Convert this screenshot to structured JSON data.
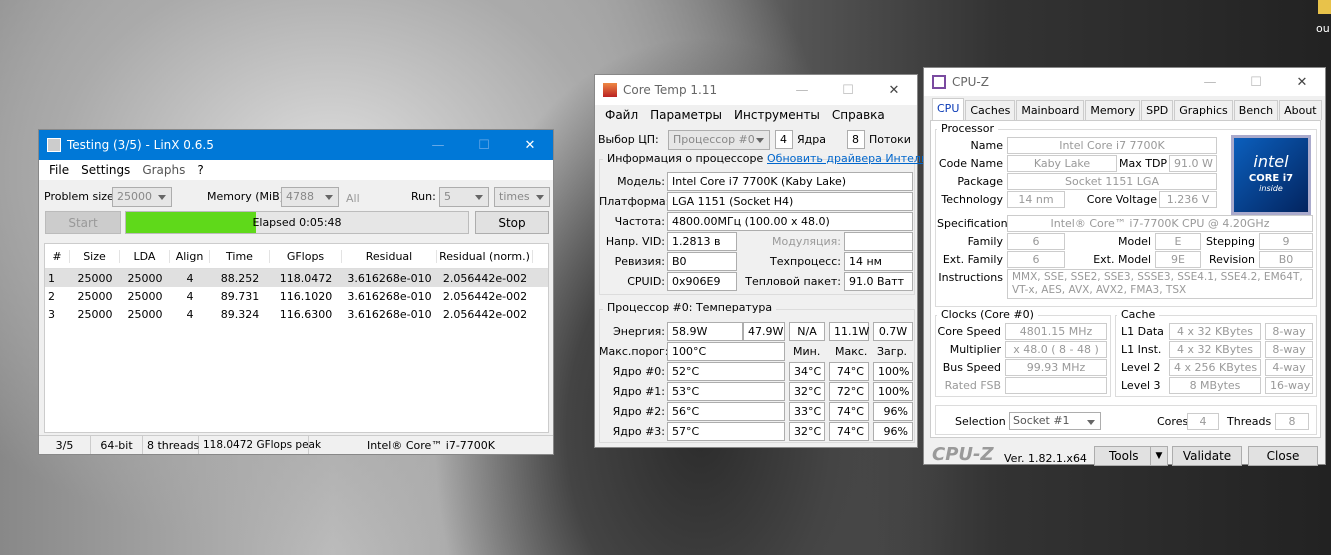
{
  "desktop_label": "ou",
  "linx": {
    "title": "Testing (3/5) - LinX 0.6.5",
    "menu": [
      "File",
      "Settings",
      "Graphs",
      "?"
    ],
    "problem_size_label": "Problem size:",
    "problem_size": "25000",
    "memory_label": "Memory (MiB):",
    "memory": "4788",
    "all_label": "All",
    "run_label": "Run:",
    "run": "5",
    "times": "times",
    "start": "Start",
    "elapsed": "Elapsed 0:05:48",
    "progress": 0.38,
    "stop": "Stop",
    "columns": [
      "#",
      "Size",
      "LDA",
      "Align",
      "Time",
      "GFlops",
      "Residual",
      "Residual (norm.)"
    ],
    "rows": [
      [
        "1",
        "25000",
        "25000",
        "4",
        "88.252",
        "118.0472",
        "3.616268e-010",
        "2.056442e-002"
      ],
      [
        "2",
        "25000",
        "25000",
        "4",
        "89.731",
        "116.1020",
        "3.616268e-010",
        "2.056442e-002"
      ],
      [
        "3",
        "25000",
        "25000",
        "4",
        "89.324",
        "116.6300",
        "3.616268e-010",
        "2.056442e-002"
      ]
    ],
    "status": [
      "3/5",
      "64-bit",
      "8 threads",
      "118.0472 GFlops peak",
      "Intel® Core™ i7-7700K"
    ]
  },
  "coretemp": {
    "title": "Core Temp 1.11",
    "menu": [
      "Файл",
      "Параметры",
      "Инструменты",
      "Справка"
    ],
    "cpu_select_label": "Выбор ЦП:",
    "cpu_select": "Процессор #0",
    "cores": "4",
    "cores_label": "Ядра",
    "threads": "8",
    "threads_label": "Потоки",
    "info_group": "Информация о процессоре",
    "update_link": "Обновить драйвера Интель",
    "model_label": "Модель:",
    "model": "Intel Core i7 7700K (Kaby Lake)",
    "platform_label": "Платформа:",
    "platform": "LGA 1151 (Socket H4)",
    "freq_label": "Частота:",
    "freq": "4800.00МГц (100.00 x 48.0)",
    "vid_label": "Напр. VID:",
    "vid": "1.2813 в",
    "mod_label": "Модуляция:",
    "rev_label": "Ревизия:",
    "rev": "B0",
    "tech_label": "Техпроцесс:",
    "tech": "14 нм",
    "cpuid_label": "CPUID:",
    "cpuid": "0x906E9",
    "tdp_label": "Тепловой пакет:",
    "tdp": "91.0 Ватт",
    "temp_group": "Процессор #0: Температура",
    "energy_label": "Энергия:",
    "energy": [
      "58.9W",
      "47.9W",
      "N/A",
      "11.1W",
      "0.7W"
    ],
    "tj_label": "Макс.порог:",
    "tj": "100°C",
    "min_h": "Мин.",
    "max_h": "Макс.",
    "load_h": "Загр.",
    "cores_t": [
      {
        "label": "Ядро #0:",
        "t": "52°C",
        "min": "34°C",
        "max": "74°C",
        "load": "100%"
      },
      {
        "label": "Ядро #1:",
        "t": "53°C",
        "min": "32°C",
        "max": "72°C",
        "load": "100%"
      },
      {
        "label": "Ядро #2:",
        "t": "56°C",
        "min": "33°C",
        "max": "74°C",
        "load": "96%"
      },
      {
        "label": "Ядро #3:",
        "t": "57°C",
        "min": "32°C",
        "max": "74°C",
        "load": "96%"
      }
    ]
  },
  "cpuz": {
    "title": "CPU-Z",
    "tabs": [
      "CPU",
      "Caches",
      "Mainboard",
      "Memory",
      "SPD",
      "Graphics",
      "Bench",
      "About"
    ],
    "processor_group": "Processor",
    "name_label": "Name",
    "name": "Intel Core i7 7700K",
    "codename_label": "Code Name",
    "codename": "Kaby Lake",
    "maxtdp_label": "Max TDP",
    "maxtdp": "91.0 W",
    "package_label": "Package",
    "package": "Socket 1151 LGA",
    "tech_label": "Technology",
    "tech": "14 nm",
    "corev_label": "Core Voltage",
    "corev": "1.236 V",
    "spec_label": "Specification",
    "spec": "Intel® Core™ i7-7700K CPU @ 4.20GHz",
    "family_label": "Family",
    "family": "6",
    "model_label": "Model",
    "model": "E",
    "stepping_label": "Stepping",
    "stepping": "9",
    "extfam_label": "Ext. Family",
    "extfam": "6",
    "extmod_label": "Ext. Model",
    "extmod": "9E",
    "revision_label": "Revision",
    "revision": "B0",
    "instr_label": "Instructions",
    "instr": "MMX, SSE, SSE2, SSE3, SSSE3, SSE4.1, SSE4.2, EM64T, VT-x, AES, AVX, AVX2, FMA3, TSX",
    "logo_brand": "intel",
    "logo_line": "CORE i7",
    "logo_inside": "inside",
    "clocks_group": "Clocks (Core #0)",
    "cs_label": "Core Speed",
    "cs": "4801.15 MHz",
    "mul_label": "Multiplier",
    "mul": "x 48.0 ( 8 - 48 )",
    "bus_label": "Bus Speed",
    "bus": "99.93 MHz",
    "fsb_label": "Rated FSB",
    "cache_group": "Cache",
    "l1d_label": "L1 Data",
    "l1d": "4 x 32 KBytes",
    "l1d_w": "8-way",
    "l1i_label": "L1 Inst.",
    "l1i": "4 x 32 KBytes",
    "l1i_w": "8-way",
    "l2_label": "Level 2",
    "l2": "4 x 256 KBytes",
    "l2_w": "4-way",
    "l3_label": "Level 3",
    "l3": "8 MBytes",
    "l3_w": "16-way",
    "sel_label": "Selection",
    "sel": "Socket #1",
    "cores_label": "Cores",
    "cores": "4",
    "threads_label": "Threads",
    "threads": "8",
    "brand": "CPU-Z",
    "version": "Ver. 1.82.1.x64",
    "tools": "Tools",
    "validate": "Validate",
    "close": "Close"
  }
}
